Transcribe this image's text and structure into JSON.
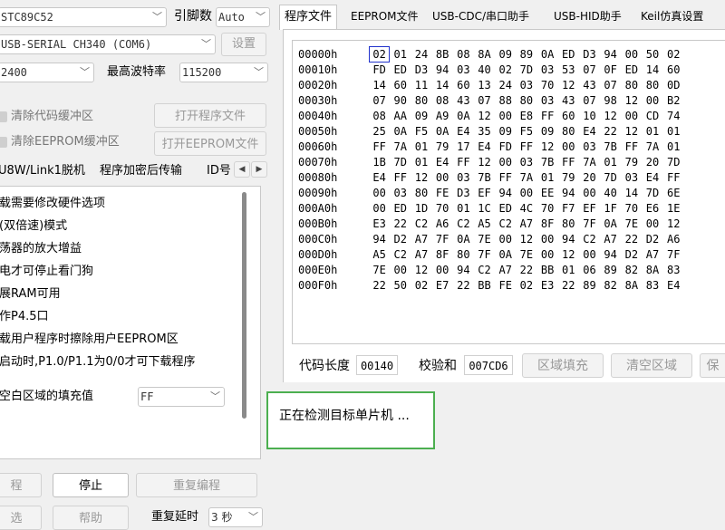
{
  "left": {
    "chip_value": "STC89C52",
    "pin_label": "引脚数",
    "pin_value": "Auto",
    "port_value": "USB-SERIAL CH340 (COM6)",
    "settings_btn": "设置",
    "baud_min_value": "2400",
    "baud_max_label": "最高波特率",
    "baud_max_value": "115200",
    "clear_code_label": "清除代码缓冲区",
    "open_program_btn": "打开程序文件",
    "clear_eeprom_label": "清除EEPROM缓冲区",
    "open_eeprom_btn": "打开EEPROM文件",
    "tabs": [
      "U8W/Link1脱机",
      "程序加密后传输",
      "ID号"
    ],
    "scroll_left": "◀",
    "scroll_right": "▶",
    "options": [
      "载需要修改硬件选项",
      "(双倍速)模式",
      "荡器的放大增益",
      "电才可停止看门狗",
      "展RAM可用",
      "作P4.5口",
      "载用户程序时擦除用户EEPROM区",
      "启动时,P1.0/P1.1为0/0才可下载程序"
    ],
    "fill_label": "空白区域的填充值",
    "fill_value": "FF",
    "btn_program": "程",
    "btn_stop": "停止",
    "btn_reprogram": "重复编程",
    "btn_check": "选",
    "btn_help": "帮助",
    "repeat_delay_label": "重复延时",
    "repeat_delay_value": "3 秒"
  },
  "right": {
    "tabs": [
      "程序文件",
      "EEPROM文件",
      "USB-CDC/串口助手",
      "USB-HID助手",
      "Keil仿真设置"
    ],
    "hex_rows": [
      {
        "addr": "00000h",
        "bytes": [
          "02",
          "01",
          "24",
          "8B",
          "08",
          "8A",
          "09",
          "89",
          "0A",
          "ED",
          "D3",
          "94",
          "00",
          "50",
          "02"
        ]
      },
      {
        "addr": "00010h",
        "bytes": [
          "FD",
          "ED",
          "D3",
          "94",
          "03",
          "40",
          "02",
          "7D",
          "03",
          "53",
          "07",
          "0F",
          "ED",
          "14",
          "60"
        ]
      },
      {
        "addr": "00020h",
        "bytes": [
          "14",
          "60",
          "11",
          "14",
          "60",
          "13",
          "24",
          "03",
          "70",
          "12",
          "43",
          "07",
          "80",
          "80",
          "0D"
        ]
      },
      {
        "addr": "00030h",
        "bytes": [
          "07",
          "90",
          "80",
          "08",
          "43",
          "07",
          "88",
          "80",
          "03",
          "43",
          "07",
          "98",
          "12",
          "00",
          "B2"
        ]
      },
      {
        "addr": "00040h",
        "bytes": [
          "08",
          "AA",
          "09",
          "A9",
          "0A",
          "12",
          "00",
          "E8",
          "FF",
          "60",
          "10",
          "12",
          "00",
          "CD",
          "74"
        ]
      },
      {
        "addr": "00050h",
        "bytes": [
          "25",
          "0A",
          "F5",
          "0A",
          "E4",
          "35",
          "09",
          "F5",
          "09",
          "80",
          "E4",
          "22",
          "12",
          "01",
          "01"
        ]
      },
      {
        "addr": "00060h",
        "bytes": [
          "FF",
          "7A",
          "01",
          "79",
          "17",
          "E4",
          "FD",
          "FF",
          "12",
          "00",
          "03",
          "7B",
          "FF",
          "7A",
          "01"
        ]
      },
      {
        "addr": "00070h",
        "bytes": [
          "1B",
          "7D",
          "01",
          "E4",
          "FF",
          "12",
          "00",
          "03",
          "7B",
          "FF",
          "7A",
          "01",
          "79",
          "20",
          "7D"
        ]
      },
      {
        "addr": "00080h",
        "bytes": [
          "E4",
          "FF",
          "12",
          "00",
          "03",
          "7B",
          "FF",
          "7A",
          "01",
          "79",
          "20",
          "7D",
          "03",
          "E4",
          "FF"
        ]
      },
      {
        "addr": "00090h",
        "bytes": [
          "00",
          "03",
          "80",
          "FE",
          "D3",
          "EF",
          "94",
          "00",
          "EE",
          "94",
          "00",
          "40",
          "14",
          "7D",
          "6E"
        ]
      },
      {
        "addr": "000A0h",
        "bytes": [
          "00",
          "ED",
          "1D",
          "70",
          "01",
          "1C",
          "ED",
          "4C",
          "70",
          "F7",
          "EF",
          "1F",
          "70",
          "E6",
          "1E"
        ]
      },
      {
        "addr": "000B0h",
        "bytes": [
          "E3",
          "22",
          "C2",
          "A6",
          "C2",
          "A5",
          "C2",
          "A7",
          "8F",
          "80",
          "7F",
          "0A",
          "7E",
          "00",
          "12"
        ]
      },
      {
        "addr": "000C0h",
        "bytes": [
          "94",
          "D2",
          "A7",
          "7F",
          "0A",
          "7E",
          "00",
          "12",
          "00",
          "94",
          "C2",
          "A7",
          "22",
          "D2",
          "A6"
        ]
      },
      {
        "addr": "000D0h",
        "bytes": [
          "A5",
          "C2",
          "A7",
          "8F",
          "80",
          "7F",
          "0A",
          "7E",
          "00",
          "12",
          "00",
          "94",
          "D2",
          "A7",
          "7F"
        ]
      },
      {
        "addr": "000E0h",
        "bytes": [
          "7E",
          "00",
          "12",
          "00",
          "94",
          "C2",
          "A7",
          "22",
          "BB",
          "01",
          "06",
          "89",
          "82",
          "8A",
          "83"
        ]
      },
      {
        "addr": "000F0h",
        "bytes": [
          "22",
          "50",
          "02",
          "E7",
          "22",
          "BB",
          "FE",
          "02",
          "E3",
          "22",
          "89",
          "82",
          "8A",
          "83",
          "E4"
        ]
      }
    ],
    "code_len_label": "代码长度",
    "code_len_value": "00140",
    "checksum_label": "校验和",
    "checksum_value": "007CD6",
    "fill_region_btn": "区域填充",
    "clear_region_btn": "清空区域",
    "save_btn": "保",
    "status_text": "正在检测目标单片机 ...",
    "status_border_color": "#4caf50",
    "selection_color": "#2233cc"
  }
}
